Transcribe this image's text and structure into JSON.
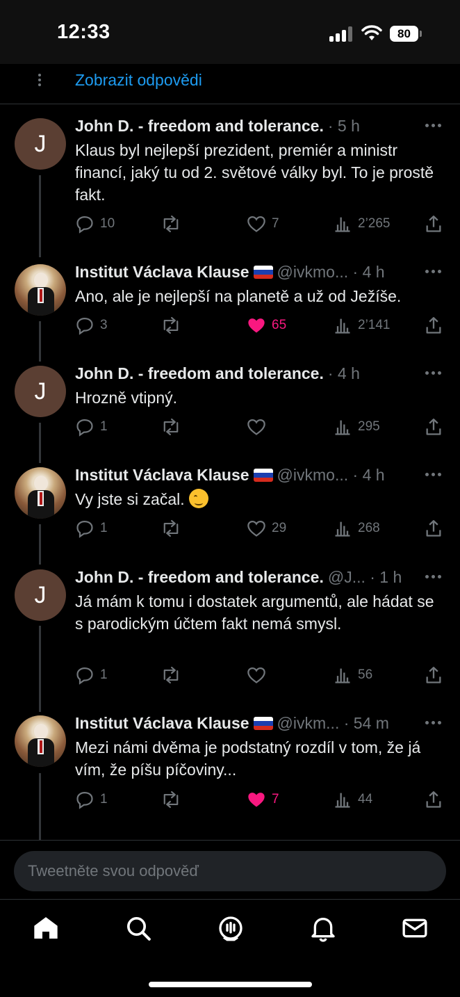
{
  "status_bar": {
    "time": "12:33",
    "battery": "80"
  },
  "show_replies": "Zobrazit odpovědi",
  "tweets": [
    {
      "avatar": "J",
      "name": "John D. - freedom and tolerance.",
      "meta": "· 5 h",
      "text": "Klaus byl nejlepší prezident, premiér a ministr financí, jaký tu od 2. světové války byl. To je prostě fakt.",
      "replies": "10",
      "retweets": "",
      "likes": "7",
      "views": "2’265",
      "liked": false
    },
    {
      "avatar_icon": "portrait-photo",
      "name": "Institut Václava Klause",
      "flag": "russian-flag-emoji",
      "meta": "@ivkmo... · 4 h",
      "text": "Ano, ale je nejlepší na planetě a už od Ježíše.",
      "replies": "3",
      "retweets": "",
      "likes": "65",
      "views": "2’141",
      "liked": true
    },
    {
      "avatar": "J",
      "name": "John D. - freedom and tolerance.",
      "meta": "· 4 h",
      "text": "Hrozně vtipný.",
      "replies": "1",
      "retweets": "",
      "likes": "",
      "views": "295",
      "liked": false
    },
    {
      "avatar_icon": "portrait-photo",
      "name": "Institut Václava Klause",
      "flag": "russian-flag-emoji",
      "meta": "@ivkmo... · 4 h",
      "text": "Vy jste si začal.",
      "emoji": "winking-face-emoji",
      "replies": "1",
      "retweets": "",
      "likes": "29",
      "views": "268",
      "liked": false
    },
    {
      "avatar": "J",
      "name": "John D. - freedom and tolerance.",
      "meta": "@J... · 1 h",
      "text": "Já mám k tomu i dostatek argumentů, ale hádat se s parodickým účtem fakt nemá smysl.",
      "replies": "1",
      "retweets": "",
      "likes": "",
      "views": "56",
      "liked": false
    },
    {
      "avatar_icon": "portrait-photo",
      "name": "Institut Václava Klause",
      "flag": "russian-flag-emoji",
      "meta": "@ivkm... · 54 m",
      "text": "Mezi námi dvěma je podstatný rozdíl v tom, že já vím, že píšu píčoviny...",
      "replies": "1",
      "retweets": "",
      "likes": "7",
      "views": "44",
      "liked": true
    }
  ],
  "compose": {
    "placeholder": "Tweetněte svou odpověď"
  },
  "tabbar": {
    "items": [
      "home-icon",
      "search-icon",
      "spaces-icon",
      "bell-icon",
      "mail-icon"
    ]
  },
  "colors": {
    "accent": "#1d9bf0",
    "like": "#f91880",
    "muted": "#71767b",
    "background": "#000000"
  }
}
